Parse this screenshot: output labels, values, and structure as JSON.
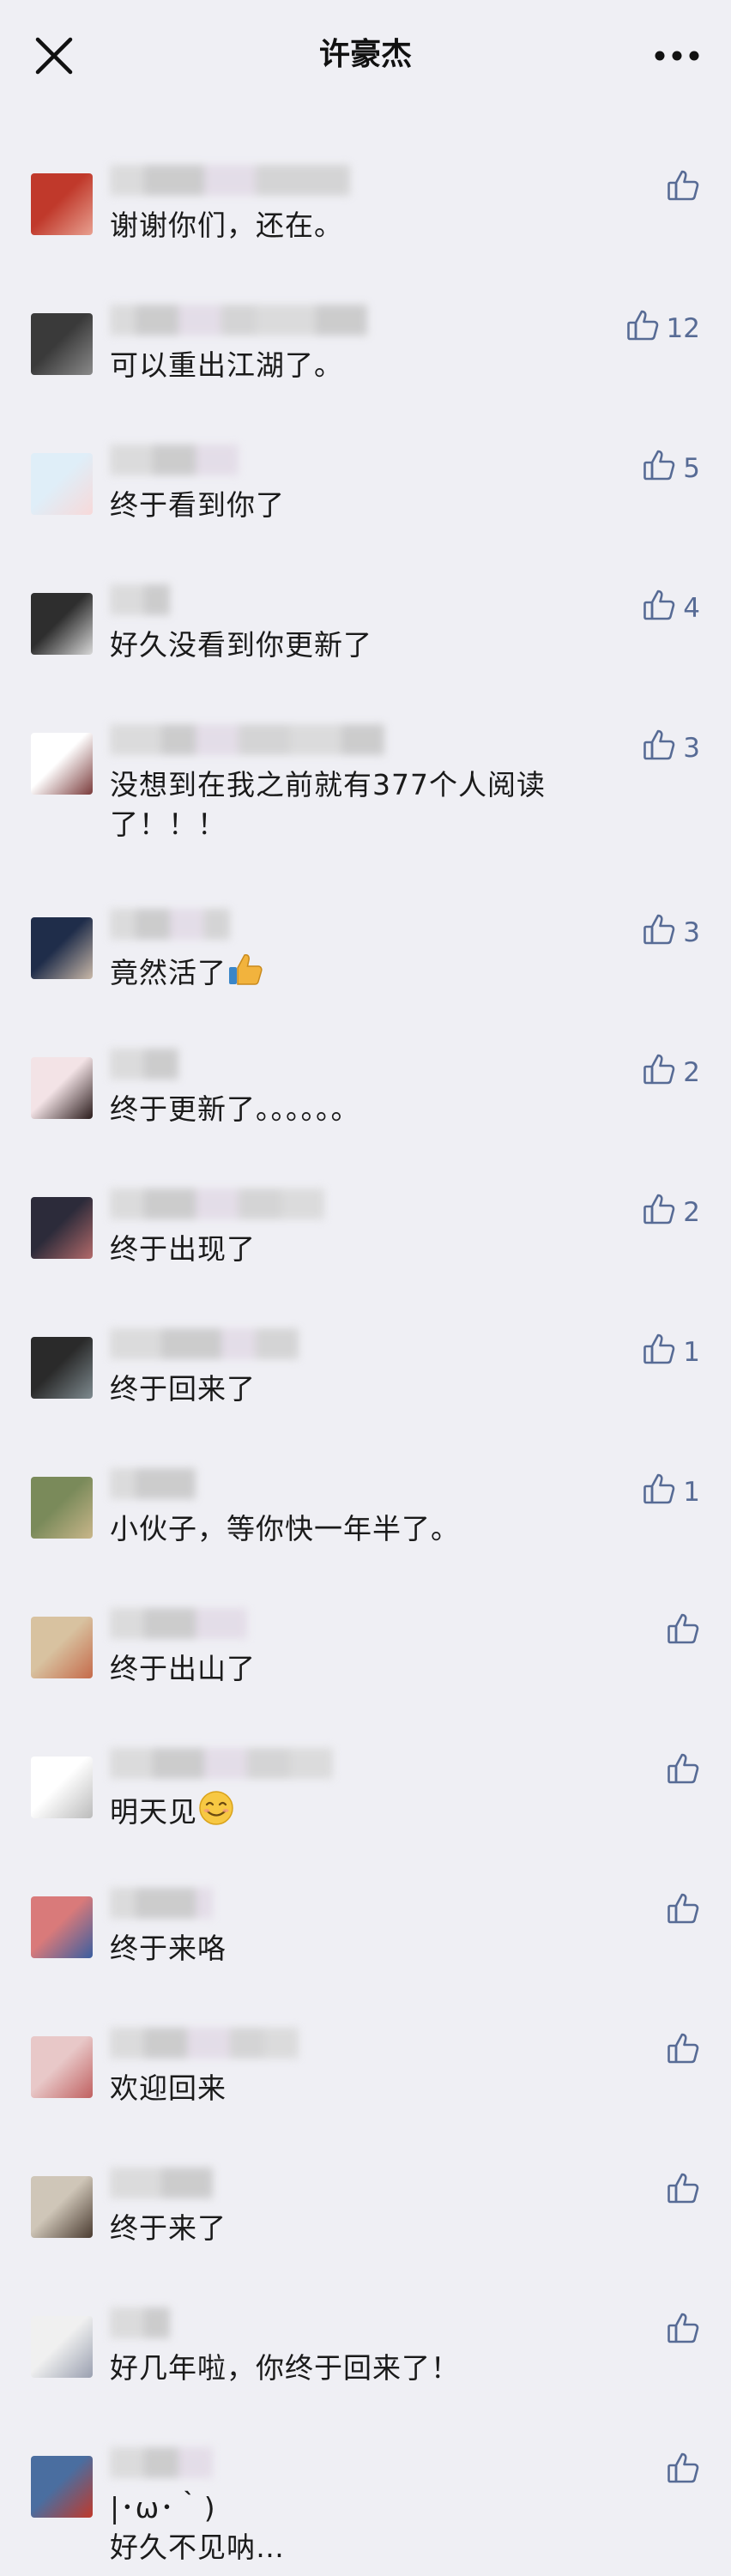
{
  "header": {
    "title": "许豪杰",
    "close_icon": "close-icon",
    "more_icon": "more-dots-icon"
  },
  "colors": {
    "background": "#efeff4",
    "like_blue": "#576b95",
    "text": "#1a1a1a"
  },
  "comments": [
    {
      "text": "谢谢你们，还在。",
      "likes": ""
    },
    {
      "text": "可以重出江湖了。",
      "likes": "12"
    },
    {
      "text": "终于看到你了",
      "likes": "5"
    },
    {
      "text": "好久没看到你更新了",
      "likes": "4"
    },
    {
      "text": "没想到在我之前就有377个人阅读\n了！！！",
      "likes": "3"
    },
    {
      "text": "竟然活了",
      "likes": "3",
      "emoji": "thumbs-up-emoji"
    },
    {
      "text": "终于更新了。。。。。。",
      "likes": "2"
    },
    {
      "text": "终于出现了",
      "likes": "2"
    },
    {
      "text": "终于回来了",
      "likes": "1"
    },
    {
      "text": "小伙子，等你快一年半了。",
      "likes": "1"
    },
    {
      "text": "终于出山了",
      "likes": ""
    },
    {
      "text": "明天见",
      "likes": "",
      "emoji": "smile-emoji"
    },
    {
      "text": "终于来咯",
      "likes": ""
    },
    {
      "text": "欢迎回来",
      "likes": ""
    },
    {
      "text": "终于来了",
      "likes": ""
    },
    {
      "text": "好几年啦，你终于回来了！",
      "likes": ""
    },
    {
      "text": "|･ω･｀)\n好久不见呐…",
      "likes": ""
    }
  ]
}
